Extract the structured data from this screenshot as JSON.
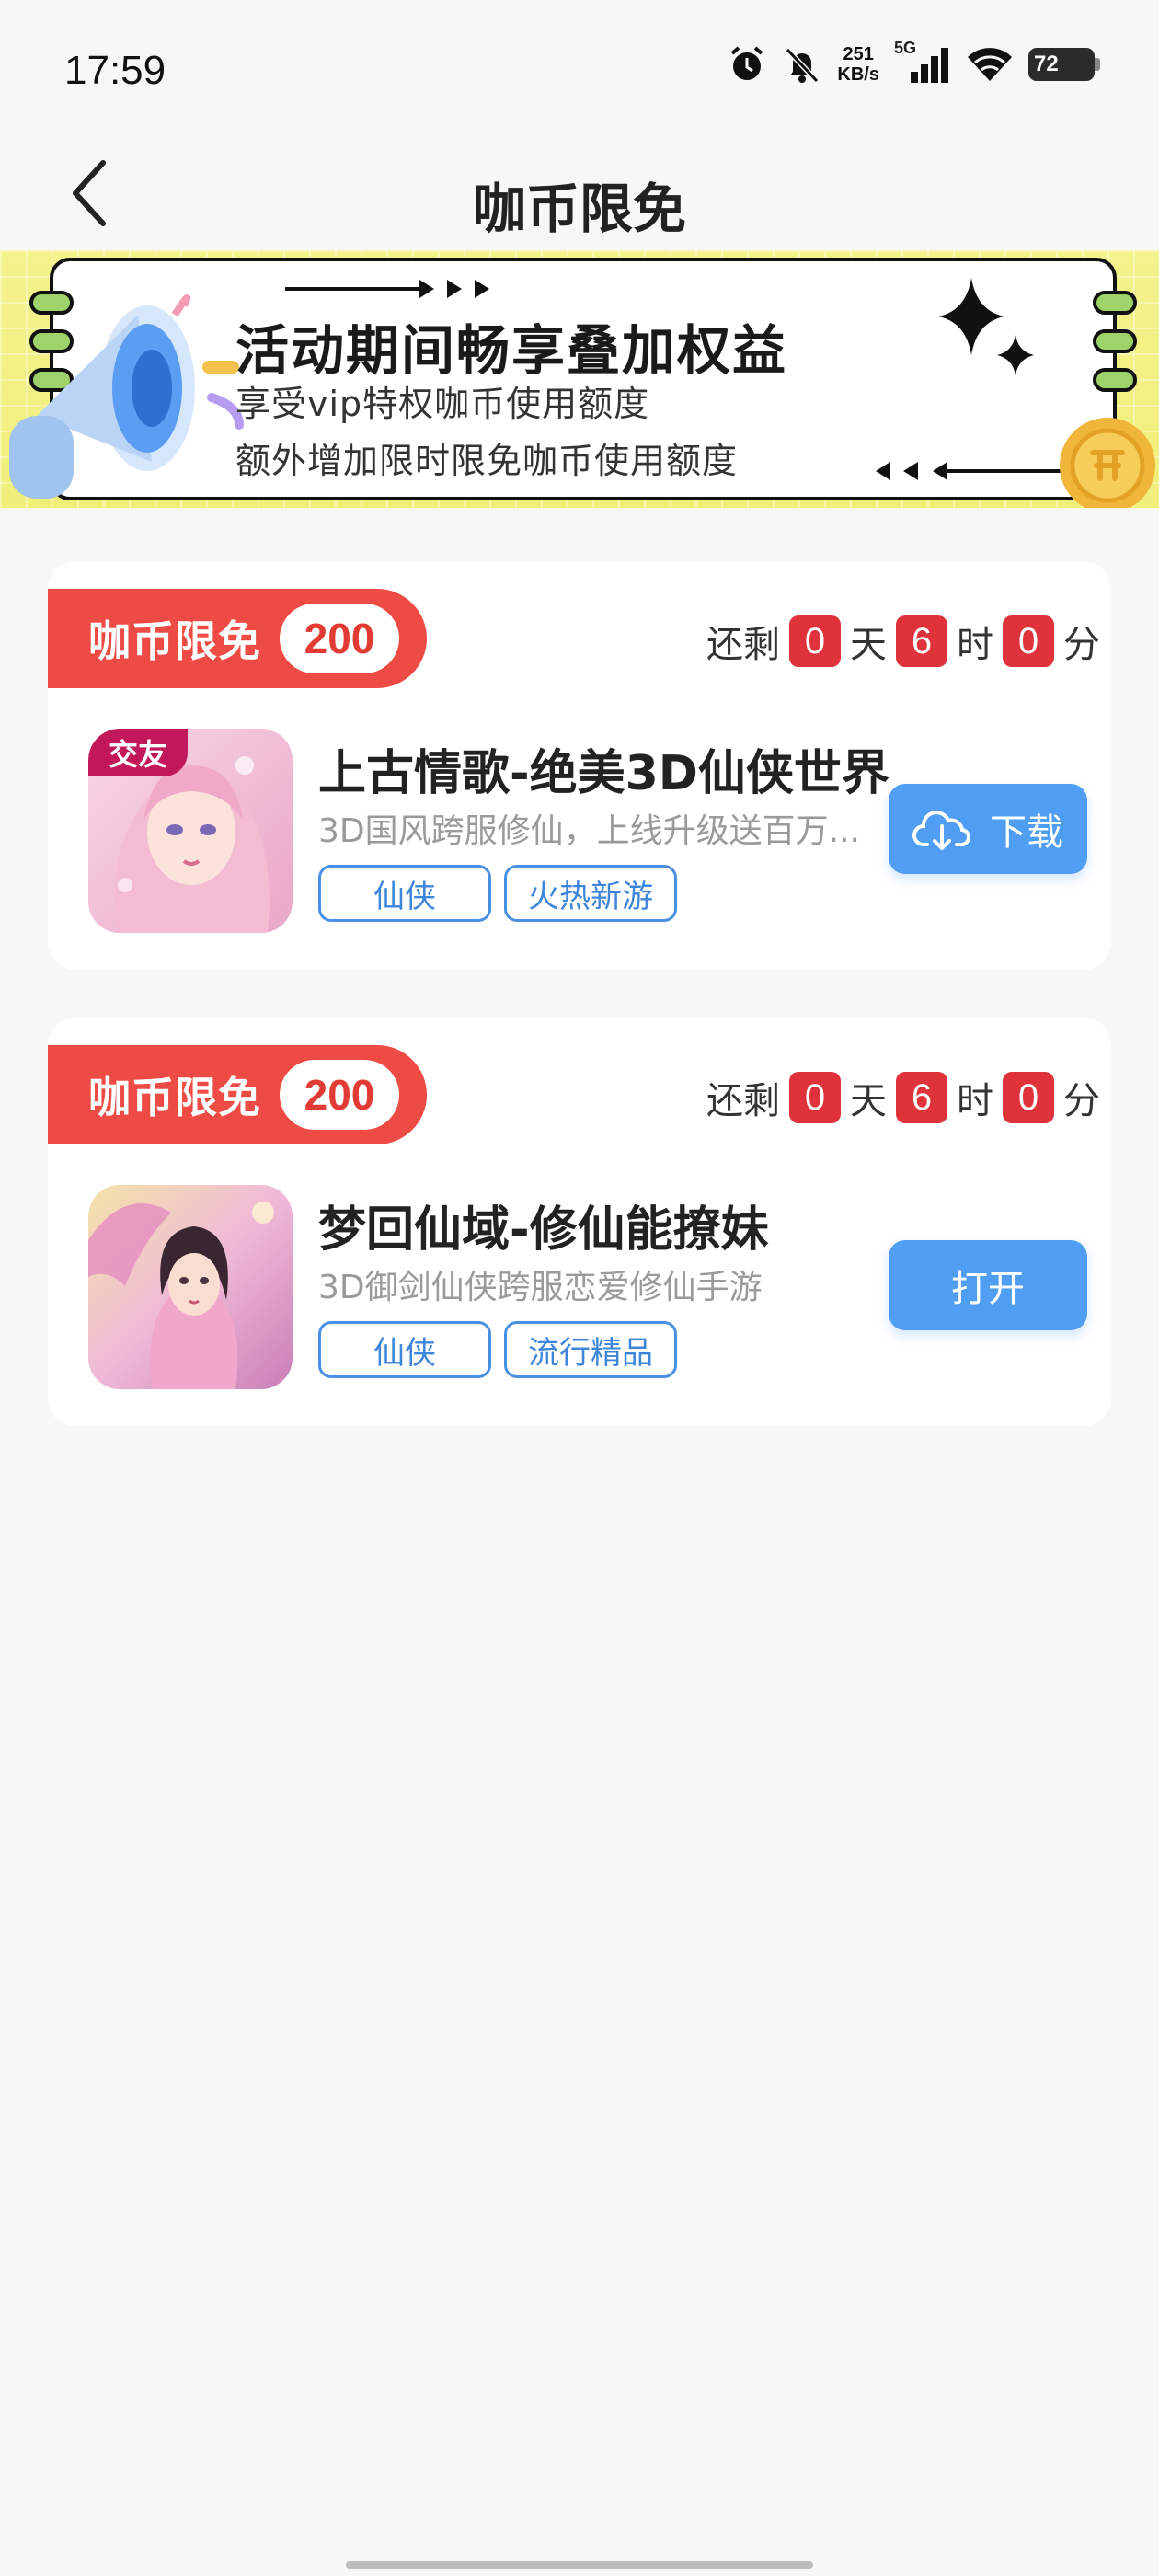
{
  "status_bar": {
    "time": "17:59",
    "net_speed_value": "251",
    "net_speed_unit": "KB/s",
    "network_type": "5G",
    "battery": "72"
  },
  "header": {
    "title": "咖币限免"
  },
  "banner": {
    "title": "活动期间畅享叠加权益",
    "line1": "享受vip特权咖币使用额度",
    "line2": "额外增加限时限免咖币使用额度"
  },
  "countdown_labels": {
    "prefix": "还剩",
    "day": "天",
    "hour": "时",
    "minute": "分"
  },
  "cards": [
    {
      "badge_label": "咖币限免",
      "badge_count": "200",
      "countdown": {
        "days": "0",
        "hours": "6",
        "minutes": "0"
      },
      "icon_tag": "交友",
      "name": "上古情歌-绝美3D仙侠世界",
      "description": "3D国风跨服修仙，上线升级送百万...",
      "tags": [
        "仙侠",
        "火热新游"
      ],
      "action_label": "下载"
    },
    {
      "badge_label": "咖币限免",
      "badge_count": "200",
      "countdown": {
        "days": "0",
        "hours": "6",
        "minutes": "0"
      },
      "name": "梦回仙域-修仙能撩妹",
      "description": "3D御剑仙侠跨服恋爱修仙手游",
      "tags": [
        "仙侠",
        "流行精品"
      ],
      "action_label": "打开"
    }
  ],
  "colors": {
    "accent_red": "#ee4b45",
    "button_blue": "#4f9ef3",
    "tag_blue": "#3d86db",
    "banner_yellow": "#f3f28c"
  }
}
